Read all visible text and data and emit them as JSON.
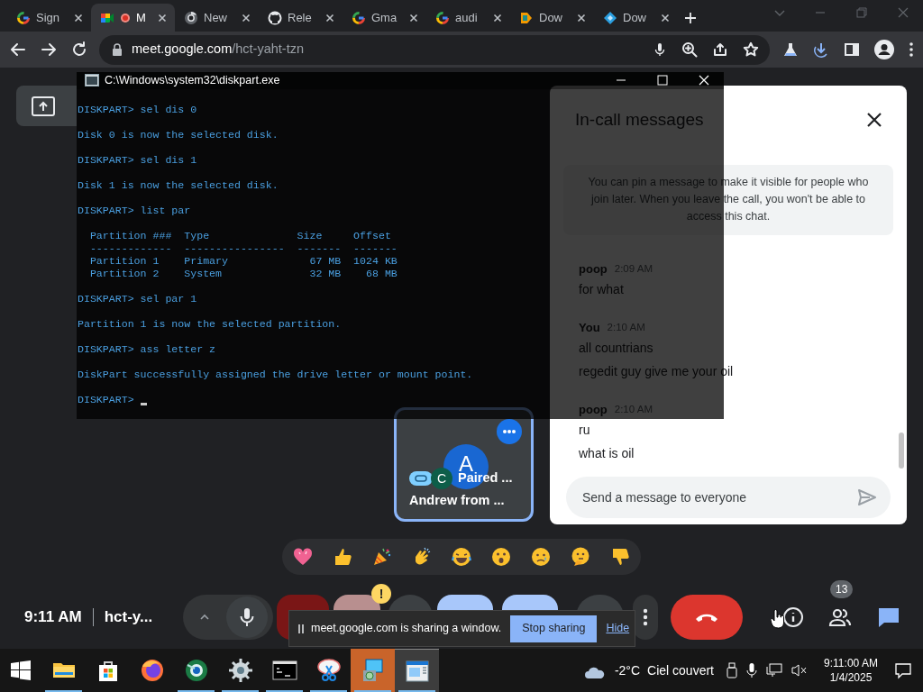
{
  "browser": {
    "tabs": [
      {
        "title": "Sign",
        "selected": false,
        "recording": false
      },
      {
        "title": "M",
        "selected": true,
        "recording": true
      },
      {
        "title": "New",
        "selected": false,
        "recording": false
      },
      {
        "title": "Rele",
        "selected": false,
        "recording": false
      },
      {
        "title": "Gma",
        "selected": false,
        "recording": false
      },
      {
        "title": "audi",
        "selected": false,
        "recording": false
      },
      {
        "title": "Dow",
        "selected": false,
        "recording": false
      },
      {
        "title": "Dow",
        "selected": false,
        "recording": false
      }
    ],
    "address": {
      "host": "meet.google.com",
      "path": "/hct-yaht-tzn"
    }
  },
  "meet": {
    "tiles": [
      {
        "kind": "self",
        "avatar": "A",
        "chip": "C",
        "label": "Paired ...",
        "name": "Andrew from ...",
        "selected": true
      }
    ],
    "chat": {
      "title": "In-call messages",
      "info": "You can pin a message to make it visible for people who join later. When you leave the call, you won't be able to access this chat.",
      "messages": [
        {
          "sender": "poop",
          "time": "2:09 AM",
          "lines": [
            "for what"
          ]
        },
        {
          "sender": "You",
          "time": "2:10 AM",
          "lines": [
            "all countrians",
            "regedit guy give me your oil"
          ]
        },
        {
          "sender": "poop",
          "time": "2:10 AM",
          "lines": [
            "ru",
            "what is oil"
          ]
        }
      ],
      "placeholder": "Send a message to everyone"
    },
    "controls": {
      "time": "9:11 AM",
      "meeting_code": "hct-y...",
      "alert_badge": "!",
      "people_count": "13"
    },
    "share_notice": {
      "text": "meet.google.com is sharing a window.",
      "button": "Stop sharing",
      "link": "Hide"
    }
  },
  "console": {
    "title": "C:\\Windows\\system32\\diskpart.exe",
    "blocks": [
      [
        "DISKPART> sel dis 0"
      ],
      [
        "Disk 0 is now the selected disk."
      ],
      [
        "DISKPART> sel dis 1"
      ],
      [
        "Disk 1 is now the selected disk."
      ],
      [
        "DISKPART> list par"
      ],
      [
        "  Partition ###  Type              Size     Offset",
        "  -------------  ----------------  -------  -------",
        "  Partition 1    Primary             67 MB  1024 KB",
        "  Partition 2    System              32 MB    68 MB"
      ],
      [
        "DISKPART> sel par 1"
      ],
      [
        "Partition 1 is now the selected partition."
      ],
      [
        "DISKPART> ass letter z"
      ],
      [
        "DiskPart successfully assigned the drive letter or mount point."
      ],
      [
        "DISKPART> "
      ]
    ]
  },
  "taskbar": {
    "apps": [
      {
        "running": true,
        "selected": false,
        "flashing": false
      },
      {
        "running": false,
        "selected": false,
        "flashing": false
      },
      {
        "running": false,
        "selected": false,
        "flashing": false
      },
      {
        "running": true,
        "selected": false,
        "flashing": false
      },
      {
        "running": true,
        "selected": false,
        "flashing": false
      },
      {
        "running": true,
        "selected": false,
        "flashing": false
      },
      {
        "running": true,
        "selected": false,
        "flashing": false
      },
      {
        "running": true,
        "selected": false,
        "flashing": true
      },
      {
        "running": true,
        "selected": true,
        "flashing": false
      }
    ],
    "temperature": "-2°C",
    "weather": "Ciel couvert",
    "time": "9:11:00 AM",
    "date": "1/4/2025"
  }
}
